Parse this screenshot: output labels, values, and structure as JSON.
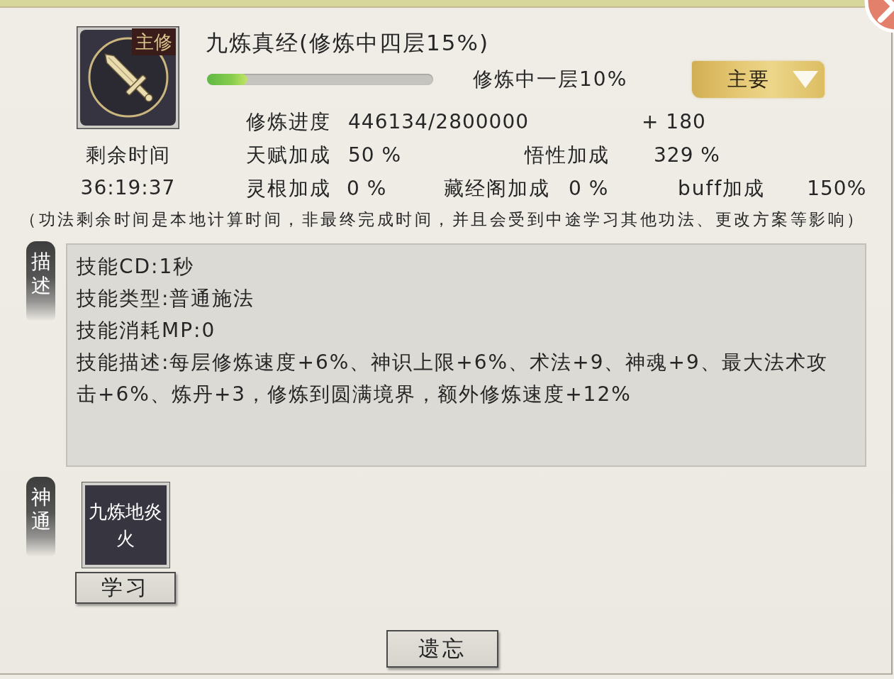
{
  "skill": {
    "tag": "主修",
    "title": "九炼真经(修炼中四层15%)",
    "progress": {
      "level": 0.18
    },
    "stage": "修炼中一层10%",
    "category": {
      "value": "主要"
    }
  },
  "remaining_time": {
    "label": "剩余时间",
    "value": "36:19:37"
  },
  "cultivation": {
    "label": "修炼进度",
    "value": "446134/2800000",
    "gain": "+ 180"
  },
  "bonus_rows": [
    {
      "items": [
        {
          "label": "天赋加成",
          "value": "50 %"
        },
        {
          "label": "悟性加成",
          "value": "329 %"
        }
      ]
    },
    {
      "items": [
        {
          "label": "灵根加成",
          "value": "0 %"
        },
        {
          "label": "藏经阁加成",
          "value": "0 %"
        },
        {
          "label": "buff加成",
          "value": "150%"
        }
      ]
    }
  ],
  "note": "（功法剩余时间是本地计算时间，非最终完成时间，并且会受到中途学习其他功法、更改方案等影响）",
  "description": {
    "label": "描述",
    "lines": [
      "技能CD:1秒",
      "技能类型:普通施法",
      "技能消耗MP:0",
      "技能描述:每层修炼速度+6%、神识上限+6%、术法+9、神魂+9、最大法术攻击+6%、炼丹+3，修炼到圆满境界，额外修炼速度+12%"
    ]
  },
  "abilities": {
    "label": "神通",
    "items": [
      {
        "name": "九炼地炎火",
        "action": "学习"
      }
    ]
  },
  "actions": [
    {
      "label": "遗忘"
    }
  ]
}
